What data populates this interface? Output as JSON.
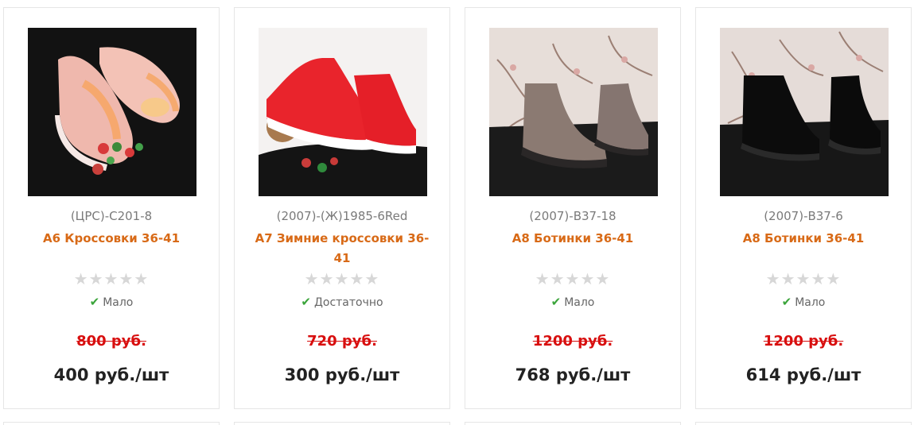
{
  "products": [
    {
      "sku": "(ЦРС)-С201-8",
      "title": "А6 Кроссовки 36-41",
      "rating_stars": "★★★★★",
      "rating": 0,
      "stock_icon": "check-icon",
      "stock": "Мало",
      "old_price": "800 руб.",
      "price": "400 руб./шт",
      "image": "pink-sneakers-photo"
    },
    {
      "sku": "(2007)-(Ж)1985-6Red",
      "title": "А7 Зимние кроссовки 36-41",
      "rating_stars": "★★★★★",
      "rating": 0,
      "stock_icon": "check-icon",
      "stock": "Достаточно",
      "old_price": "720 руб.",
      "price": "300 руб./шт",
      "image": "red-winter-sneakers-photo"
    },
    {
      "sku": "(2007)-В37-18",
      "title": "А8 Ботинки 36-41",
      "rating_stars": "★★★★★",
      "rating": 0,
      "stock_icon": "check-icon",
      "stock": "Мало",
      "old_price": "1200 руб.",
      "price": "768 руб./шт",
      "image": "grey-boots-photo"
    },
    {
      "sku": "(2007)-В37-6",
      "title": "А8 Ботинки 36-41",
      "rating_stars": "★★★★★",
      "rating": 0,
      "stock_icon": "check-icon",
      "stock": "Мало",
      "old_price": "1200 руб.",
      "price": "614 руб./шт",
      "image": "black-boots-photo"
    }
  ],
  "colors": {
    "title": "#d86a17",
    "old_price": "#d80f0f",
    "price": "#222222",
    "star_empty": "#d7d7d7",
    "stock_check": "#3aa43a"
  }
}
